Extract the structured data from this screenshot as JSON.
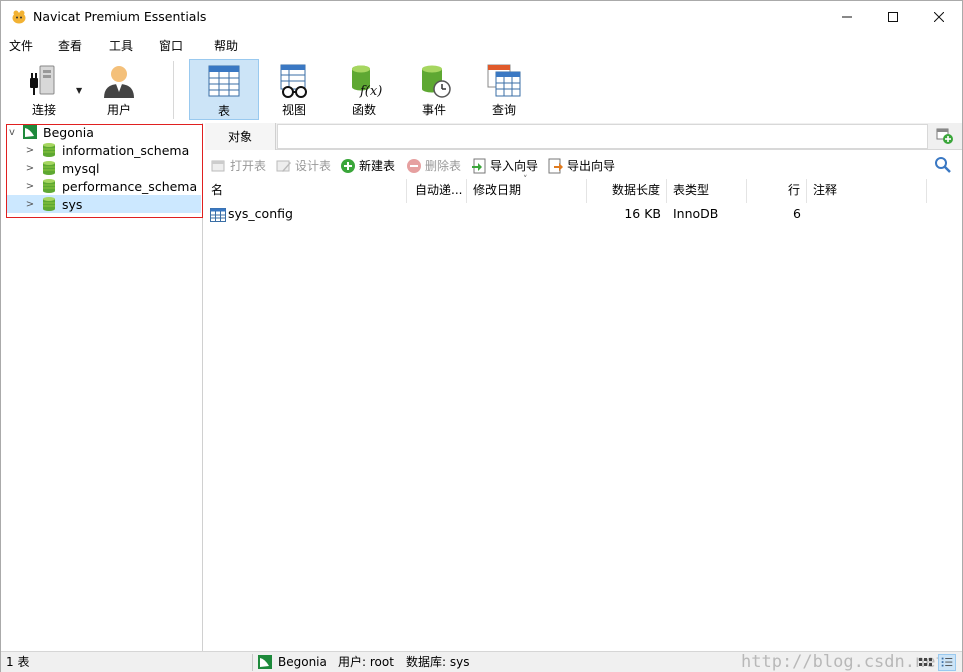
{
  "window": {
    "title": "Navicat Premium Essentials",
    "controls": {
      "minimize": "—",
      "maximize": "☐",
      "close": "✕"
    }
  },
  "menu": [
    "文件",
    "查看",
    "工具",
    "窗口",
    "帮助"
  ],
  "toolbar": {
    "connect": "连接",
    "user": "用户",
    "table": "表",
    "view": "视图",
    "function": "函数",
    "event": "事件",
    "query": "查询",
    "dropdown_glyph": "▼",
    "function_glyph": "f(x)"
  },
  "tree": {
    "connection": "Begonia",
    "databases": [
      "information_schema",
      "mysql",
      "performance_schema",
      "sys"
    ],
    "selected": "sys",
    "collapse_glyph": "v",
    "expand_glyph": ">"
  },
  "tabs": {
    "objects": "对象"
  },
  "object_toolbar": {
    "open": "打开表",
    "design": "设计表",
    "new": "新建表",
    "delete": "删除表",
    "import": "导入向导",
    "export": "导出向导"
  },
  "grid": {
    "headers": [
      "名",
      "自动递...",
      "修改日期",
      "数据长度",
      "表类型",
      "行",
      "注释"
    ],
    "sort_glyph": "˅",
    "rows": [
      {
        "name": "sys_config",
        "auto_inc": "",
        "modified": "",
        "data_length": "16 KB",
        "engine": "InnoDB",
        "rows": "6",
        "comment": ""
      }
    ]
  },
  "status": {
    "count": "1 表",
    "connection": "Begonia",
    "user": "用户: root",
    "database": "数据库: sys",
    "watermark": "http://blog.csdn.net/"
  },
  "colors": {
    "accent": "#cce4f7",
    "selection": "#cce8ff",
    "highlight_border": "#e02020",
    "db_green": "#5ea832"
  }
}
